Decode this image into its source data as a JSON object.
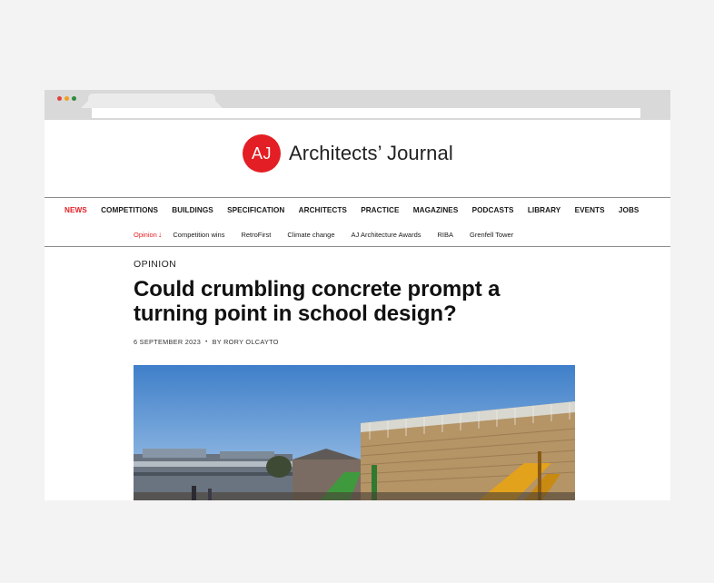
{
  "site": {
    "logo_mark": "AJ",
    "name": "Architects’ Journal",
    "brand_color": "#e31e24"
  },
  "nav": {
    "items": [
      {
        "label": "NEWS",
        "active": true
      },
      {
        "label": "COMPETITIONS"
      },
      {
        "label": "BUILDINGS"
      },
      {
        "label": "SPECIFICATION"
      },
      {
        "label": "ARCHITECTS"
      },
      {
        "label": "PRACTICE"
      },
      {
        "label": "MAGAZINES"
      },
      {
        "label": "PODCASTS"
      },
      {
        "label": "LIBRARY"
      },
      {
        "label": "EVENTS"
      },
      {
        "label": "JOBS"
      }
    ]
  },
  "subnav": {
    "items": [
      {
        "label": "Opinion",
        "active": true,
        "icon": "arrow-down-icon"
      },
      {
        "label": "Competition wins"
      },
      {
        "label": "RetroFirst"
      },
      {
        "label": "Climate change"
      },
      {
        "label": "AJ Architecture Awards"
      },
      {
        "label": "RIBA"
      },
      {
        "label": "Grenfell Tower"
      }
    ]
  },
  "article": {
    "kicker": "OPINION",
    "headline": "Could crumbling concrete prompt a turning point in school design?",
    "date": "6 SEPTEMBER 2023",
    "separator": "•",
    "byline": "BY RORY OLCAYTO",
    "hero_image": "school-building-photo"
  }
}
